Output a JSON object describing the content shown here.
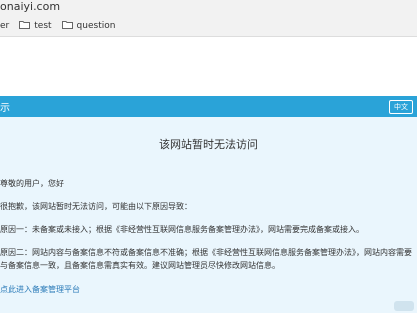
{
  "browser": {
    "url_fragment": "onaiyi.com",
    "bookmarks": [
      {
        "label": "er"
      },
      {
        "label": "test"
      },
      {
        "label": "question"
      }
    ]
  },
  "notice": {
    "title": "示",
    "lang_button": "中文",
    "headline": "该网站暂时无法访问",
    "greeting": "尊敬的用户，您好",
    "intro": "很抱歉，该网站暂时无法访问，可能由以下原因导致：",
    "reason1": "原因一：未备案或未接入；根据《非经营性互联网信息服务备案管理办法》，网站需要完成备案或接入。",
    "reason2_line1": "原因二：网站内容与备案信息不符或备案信息不准确；根据《非经营性互联网信息服务备案管理办法》，网站内容需要",
    "reason2_line2": "与备案信息一致，且备案信息需真实有效。建议网站管理员尽快修改网站信息。",
    "link_text": "点此进入备案管理平台"
  },
  "colors": {
    "header_bg": "#2aa3d8",
    "body_bg": "#eaf6fd",
    "link": "#2a7ab8"
  }
}
